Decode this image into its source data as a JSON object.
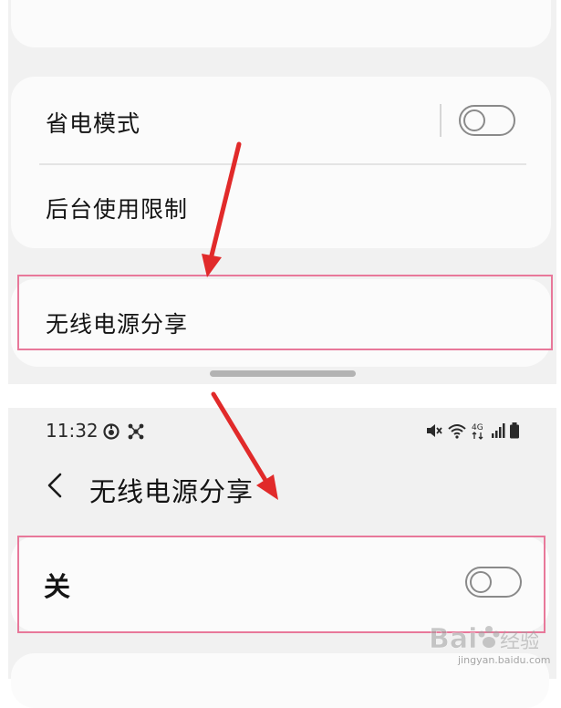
{
  "settings": {
    "power_saving_label": "省电模式",
    "background_limits_label": "后台使用限制",
    "wireless_power_share_label": "无线电源分享"
  },
  "status_bar": {
    "time": "11:32",
    "icons": [
      "notification-icon",
      "app-icon",
      "mute-icon",
      "wifi-icon",
      "4g-icon",
      "signal-icon",
      "battery-icon"
    ]
  },
  "detail": {
    "title": "无线电源分享",
    "toggle_label": "关"
  },
  "watermark": {
    "text": "Bai",
    "text2": "经验",
    "sub": "jingyan.baidu.com"
  },
  "colors": {
    "highlight": "#e8789a",
    "arrow": "#e12a2a",
    "panel": "#f1f1f1",
    "card": "#fbfbfb"
  }
}
